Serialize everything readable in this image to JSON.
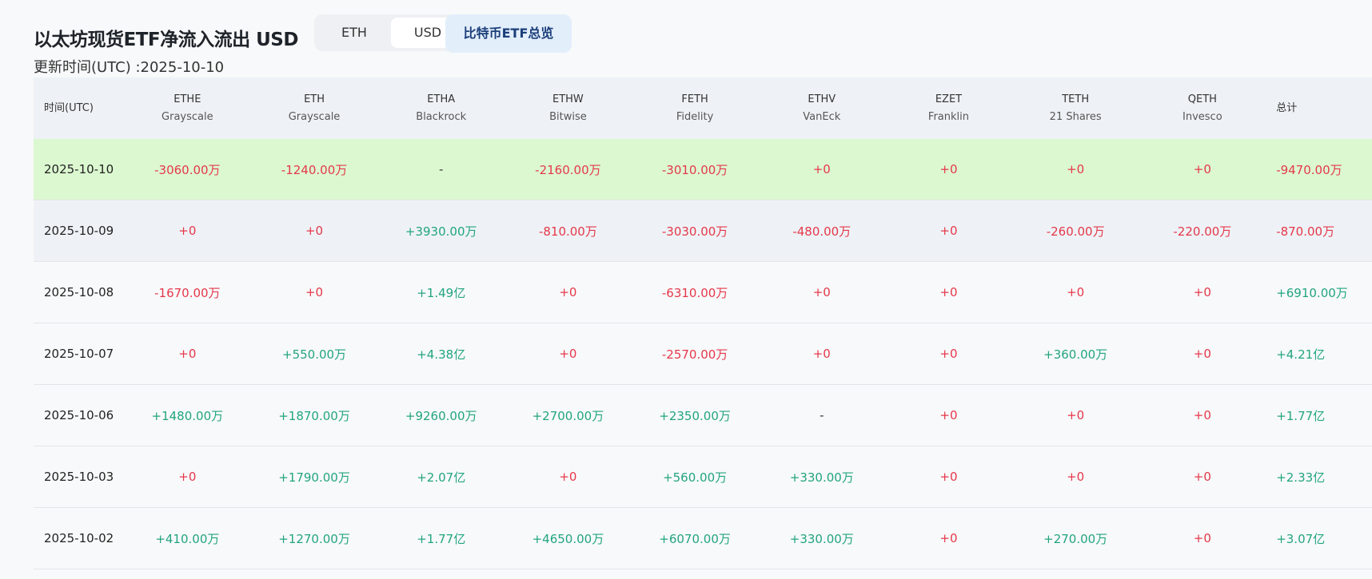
{
  "header": {
    "title": "以太坊现货ETF净流入流出 USD",
    "toggle": [
      "ETH",
      "USD"
    ],
    "active_toggle": "USD",
    "btc_button": "比特币ETF总览",
    "updated": "更新时间(UTC) :2025-10-10"
  },
  "columns": [
    {
      "ticker": "时间(UTC)",
      "issuer": ""
    },
    {
      "ticker": "ETHE",
      "issuer": "Grayscale"
    },
    {
      "ticker": "ETH",
      "issuer": "Grayscale"
    },
    {
      "ticker": "ETHA",
      "issuer": "Blackrock"
    },
    {
      "ticker": "ETHW",
      "issuer": "Bitwise"
    },
    {
      "ticker": "FETH",
      "issuer": "Fidelity"
    },
    {
      "ticker": "ETHV",
      "issuer": "VanEck"
    },
    {
      "ticker": "EZET",
      "issuer": "Franklin"
    },
    {
      "ticker": "TETH",
      "issuer": "21 Shares"
    },
    {
      "ticker": "QETH",
      "issuer": "Invesco"
    },
    {
      "ticker": "总计",
      "issuer": ""
    }
  ],
  "rows": [
    {
      "date": "2025-10-10",
      "values": [
        "-3060.00万",
        "-1240.00万",
        "-",
        "-2160.00万",
        "-3010.00万",
        "+0",
        "+0",
        "+0",
        "+0",
        "-9470.00万"
      ]
    },
    {
      "date": "2025-10-09",
      "values": [
        "+0",
        "+0",
        "+3930.00万",
        "-810.00万",
        "-3030.00万",
        "-480.00万",
        "+0",
        "-260.00万",
        "-220.00万",
        "-870.00万"
      ]
    },
    {
      "date": "2025-10-08",
      "values": [
        "-1670.00万",
        "+0",
        "+1.49亿",
        "+0",
        "-6310.00万",
        "+0",
        "+0",
        "+0",
        "+0",
        "+6910.00万"
      ]
    },
    {
      "date": "2025-10-07",
      "values": [
        "+0",
        "+550.00万",
        "+4.38亿",
        "+0",
        "-2570.00万",
        "+0",
        "+0",
        "+360.00万",
        "+0",
        "+4.21亿"
      ]
    },
    {
      "date": "2025-10-06",
      "values": [
        "+1480.00万",
        "+1870.00万",
        "+9260.00万",
        "+2700.00万",
        "+2350.00万",
        "-",
        "+0",
        "+0",
        "+0",
        "+1.77亿"
      ]
    },
    {
      "date": "2025-10-03",
      "values": [
        "+0",
        "+1790.00万",
        "+2.07亿",
        "+0",
        "+560.00万",
        "+330.00万",
        "+0",
        "+0",
        "+0",
        "+2.33亿"
      ]
    },
    {
      "date": "2025-10-02",
      "values": [
        "+410.00万",
        "+1270.00万",
        "+1.77亿",
        "+4650.00万",
        "+6070.00万",
        "+330.00万",
        "+0",
        "+270.00万",
        "+0",
        "+3.07亿"
      ]
    }
  ],
  "colors": {
    "negative": "#e5384b",
    "positive": "#22a57e",
    "highlight_row": "#dcf8d0"
  }
}
